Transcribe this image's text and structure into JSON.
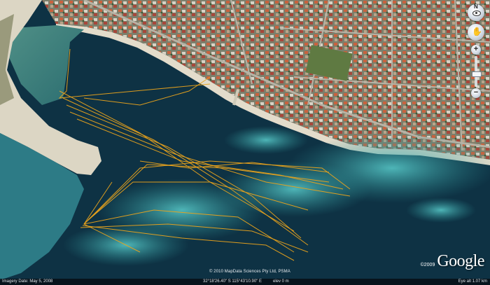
{
  "imagery": {
    "copyright": "© 2010 MapData Sciences Pty Ltd, PSMA",
    "logo_year": "©2009",
    "logo_text": "Google"
  },
  "status_bar": {
    "imagery_date": "Imagery Date: May 5, 2008",
    "coordinates": "32°18'26.40\" S    115°43'10.90\" E",
    "elevation": "elev   0 m",
    "eye_alt": "Eye alt   1.07 km"
  },
  "navigation": {
    "north_label": "N",
    "zoom_in": "+",
    "zoom_out": "−",
    "move_glyph": "✋"
  },
  "colors": {
    "deep_water": "#0e3244",
    "shallow_water": "#2a8a8f",
    "sand": "#dcd6c4",
    "track": "#e8a21c"
  }
}
